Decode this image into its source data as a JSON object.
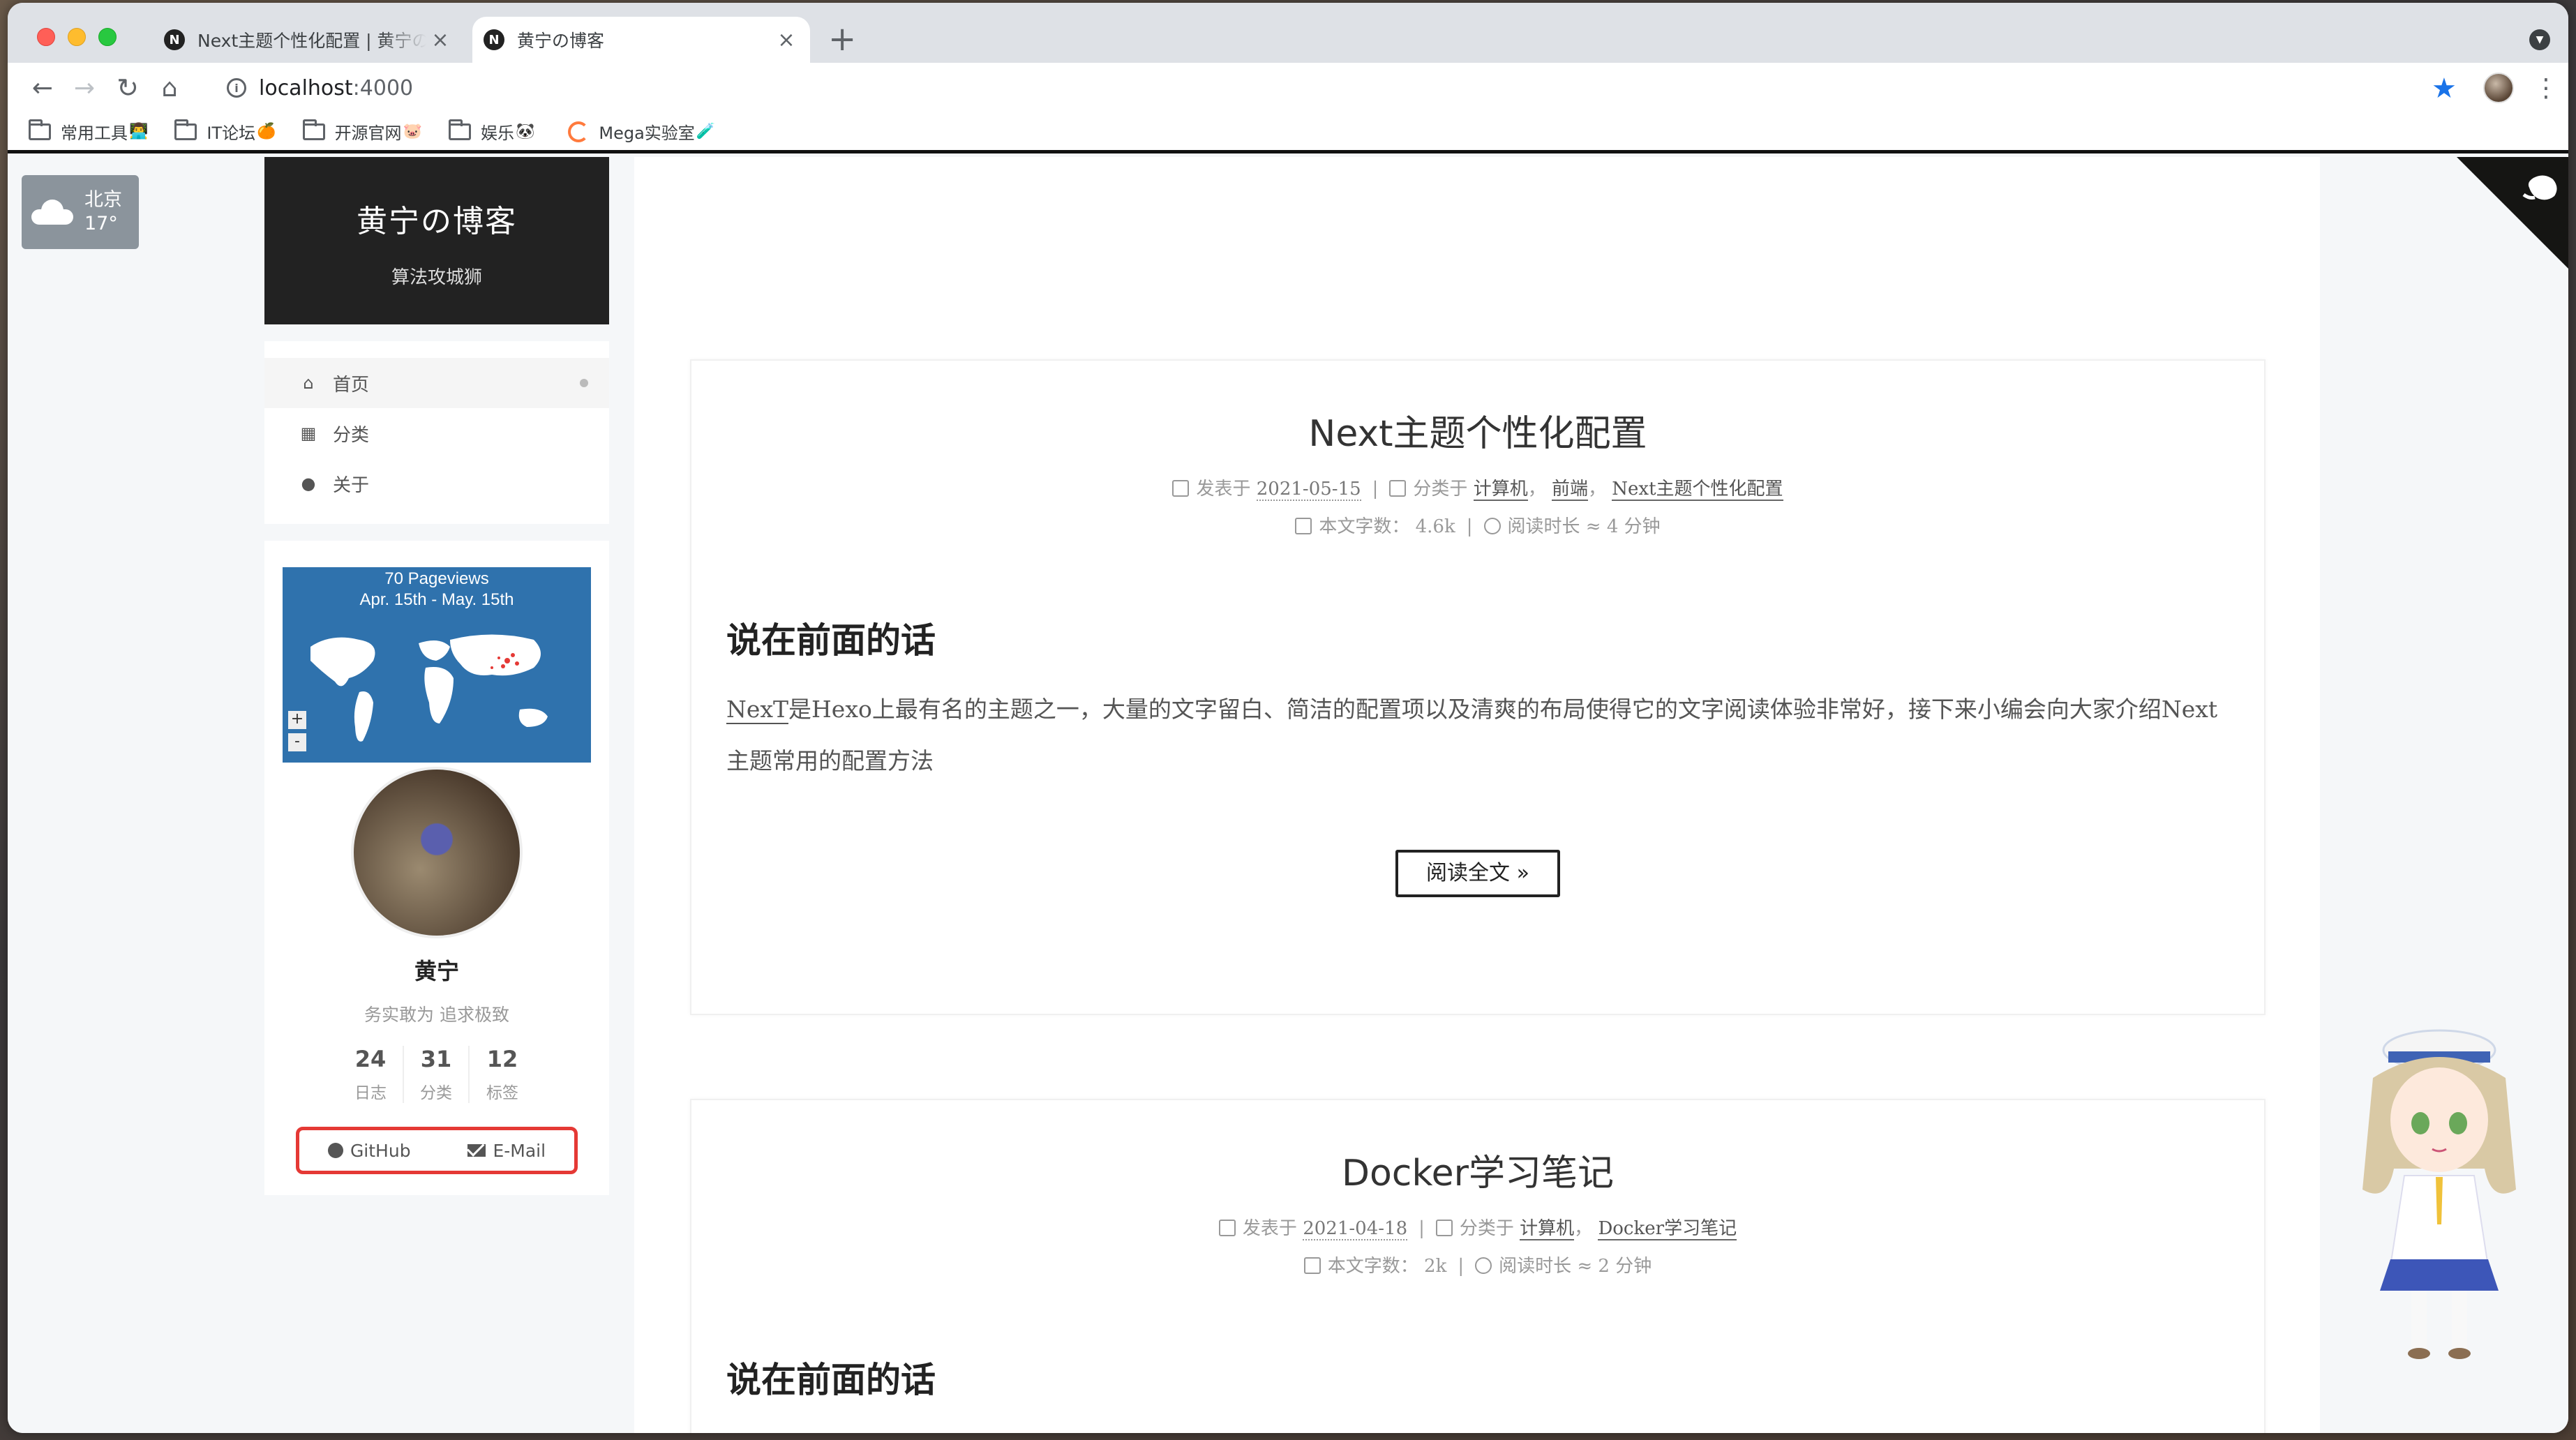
{
  "browser": {
    "tabs": [
      {
        "favicon": "N",
        "title": "Next主题个性化配置 | 黄宁の博客",
        "close": "×"
      },
      {
        "favicon": "N",
        "title": "黄宁の博客",
        "close": "×"
      }
    ],
    "new_tab": "+",
    "url_host": "localhost",
    "url_port": ":4000",
    "bookmarks": [
      {
        "label": "常用工具",
        "emoji": "👨‍💻"
      },
      {
        "label": "IT论坛",
        "emoji": "🍊"
      },
      {
        "label": "开源官网",
        "emoji": "🐷"
      },
      {
        "label": "娱乐",
        "emoji": "🐼"
      },
      {
        "label": "Mega实验室",
        "emoji": "🧪"
      }
    ],
    "accent_color": "#1a73e8"
  },
  "weather": {
    "city": "北京",
    "temp": "17°"
  },
  "site": {
    "title": "黄宁の博客",
    "subtitle": "算法攻城狮"
  },
  "menu": [
    {
      "icon": "home-icon",
      "glyph": "⌂",
      "label": "首页"
    },
    {
      "icon": "grid-icon",
      "glyph": "▦",
      "label": "分类"
    },
    {
      "icon": "user-icon",
      "glyph": "●",
      "label": "关于"
    }
  ],
  "map": {
    "line1": "70 Pageviews",
    "line2": "Apr. 15th - May. 15th",
    "zoom_in": "+",
    "zoom_out": "-"
  },
  "author": {
    "name": "黄宁",
    "description": "务实敢为 追求极致"
  },
  "stats": [
    {
      "count": "24",
      "label": "日志"
    },
    {
      "count": "31",
      "label": "分类"
    },
    {
      "count": "12",
      "label": "标签"
    }
  ],
  "social": {
    "github": "GitHub",
    "email": "E-Mail"
  },
  "posts": [
    {
      "title": "Next主题个性化配置",
      "posted_label": "发表于",
      "date": "2021-05-15",
      "category_label": "分类于",
      "categories": [
        "计算机",
        "前端",
        "Next主题个性化配置"
      ],
      "wordcount_label": "本文字数：",
      "wordcount": "4.6k",
      "readtime_label": "阅读时长 ≈",
      "readtime": "4 分钟",
      "heading": "说在前面的话",
      "excerpt_link": "NexT",
      "excerpt": "是Hexo上最有名的主题之一，大量的文字留白、简洁的配置项以及清爽的布局使得它的文字阅读体验非常好，接下来小编会向大家介绍Next主题常用的配置方法",
      "read_more": "阅读全文 »"
    },
    {
      "title": "Docker学习笔记",
      "posted_label": "发表于",
      "date": "2021-04-18",
      "category_label": "分类于",
      "categories": [
        "计算机",
        "Docker学习笔记"
      ],
      "wordcount_label": "本文字数：",
      "wordcount": "2k",
      "readtime_label": "阅读时长 ≈",
      "readtime": "2 分钟",
      "heading": "说在前面的话"
    }
  ],
  "colors": {
    "brand_bg": "#222222",
    "highlight_border": "#e53935",
    "map_blue": "#2f72ad"
  }
}
